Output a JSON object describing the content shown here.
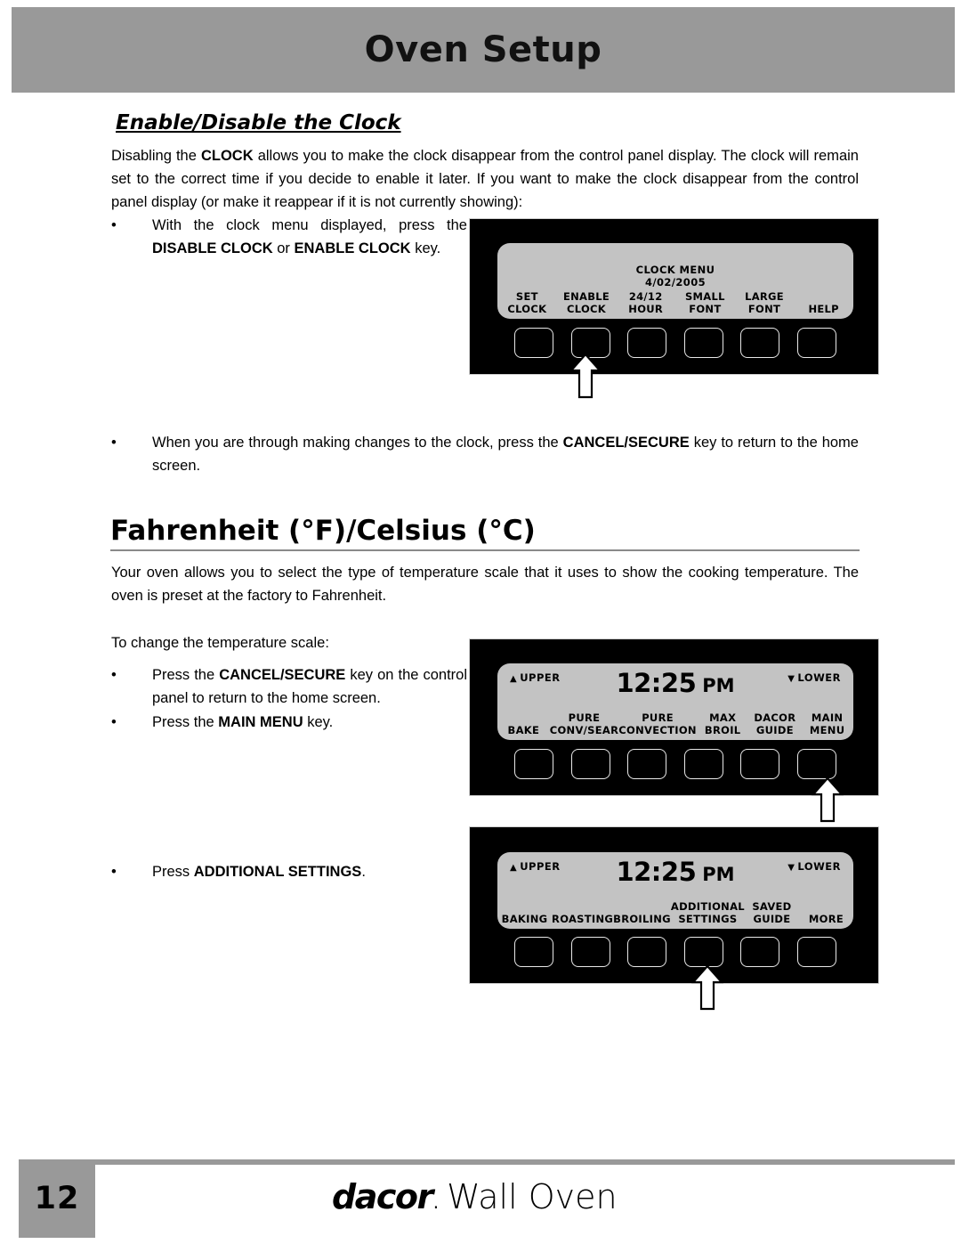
{
  "header": {
    "title": "Oven Setup"
  },
  "section1": {
    "heading": "Enable/Disable the Clock",
    "intro": "Disabling the CLOCK allows you to make the clock disappear from the control panel display. The clock will remain set to the correct time if you decide to enable it later. If you want to make the clock disappear from the control panel display (or make it reappear if it is not currently showing):",
    "intro_p1": "Disabling the ",
    "intro_b1": "CLOCK",
    "intro_p2": " allows you to make the clock disappear from the control panel display. The clock will remain set to the correct time if you decide to enable it later. If you want to make the clock disappear from the control panel display (or make it reappear if it is not currently showing):",
    "bullet1_dot": "•",
    "bullet1_p1": "With the clock menu displayed, press the ",
    "bullet1_b1": "DISABLE CLOCK",
    "bullet1_p2": " or ",
    "bullet1_b2": "ENABLE CLOCK",
    "bullet1_p3": " key.",
    "bullet2_dot": "•",
    "bullet2_p1": "When you are through making changes to the clock, press the ",
    "bullet2_b1": "CANCEL/SECURE",
    "bullet2_p2": " key to return to the home screen."
  },
  "section2": {
    "heading": "Fahrenheit (°F)/Celsius (°C)",
    "intro": "Your oven allows you to select the type of temperature scale that it uses to show the cooking temperature. The oven is preset at the factory to Fahrenheit.",
    "lead_in": "To change the temperature scale:",
    "bullet1_dot": "•",
    "bullet1_p1": "Press the ",
    "bullet1_b1": "CANCEL/SECURE",
    "bullet1_p2": " key on the control panel to return to the home screen.",
    "bullet2_dot": "•",
    "bullet2_p1": "Press the ",
    "bullet2_b1": "MAIN MENU",
    "bullet2_p2": " key.",
    "bullet3_dot": "•",
    "bullet3_p1": "Press ",
    "bullet3_b1": "ADDITIONAL SETTINGS",
    "bullet3_p2": "."
  },
  "panel_clock_menu": {
    "display_title": "CLOCK MENU",
    "display_date": "4/02/2005",
    "labels": [
      {
        "line1": "SET",
        "line2": "CLOCK"
      },
      {
        "line1": "ENABLE",
        "line2": "CLOCK"
      },
      {
        "line1": "24/12",
        "line2": "HOUR"
      },
      {
        "line1": "SMALL",
        "line2": "FONT"
      },
      {
        "line1": "LARGE",
        "line2": "FONT"
      },
      {
        "line1": "",
        "line2": "HELP"
      }
    ],
    "arrow_key_index": 1
  },
  "panel_home": {
    "upper_tri": "▲",
    "upper_label": "UPPER",
    "lower_tri": "▼",
    "lower_label": "LOWER",
    "clock_time": "12:25",
    "clock_ampm": "PM",
    "labels": [
      {
        "line1": "",
        "line2": "BAKE"
      },
      {
        "line1": "PURE",
        "line2": "CONV/SEAR"
      },
      {
        "line1": "PURE",
        "line2": "CONVECTION"
      },
      {
        "line1": "MAX",
        "line2": "BROIL"
      },
      {
        "line1": "DACOR",
        "line2": "GUIDE"
      },
      {
        "line1": "MAIN",
        "line2": "MENU"
      }
    ],
    "arrow_key_index": 5
  },
  "panel_main_menu": {
    "upper_tri": "▲",
    "upper_label": "UPPER",
    "lower_tri": "▼",
    "lower_label": "LOWER",
    "clock_time": "12:25",
    "clock_ampm": "PM",
    "labels": [
      {
        "line1": "",
        "line2": "BAKING"
      },
      {
        "line1": "",
        "line2": "ROASTING"
      },
      {
        "line1": "",
        "line2": "BROILING"
      },
      {
        "line1": "ADDITIONAL",
        "line2": "SETTINGS"
      },
      {
        "line1": "SAVED",
        "line2": "GUIDE"
      },
      {
        "line1": "",
        "line2": "MORE"
      }
    ],
    "arrow_key_index": 3
  },
  "footer": {
    "page_number": "12",
    "brand": "dacor",
    "brand_dot": ".",
    "brand_rest": "Wall Oven"
  },
  "colors": {
    "gray_bar": "#999999",
    "panel_black": "#000000",
    "screen_gray": "#c3c3c3",
    "rule_gray": "#8a8a8a"
  }
}
